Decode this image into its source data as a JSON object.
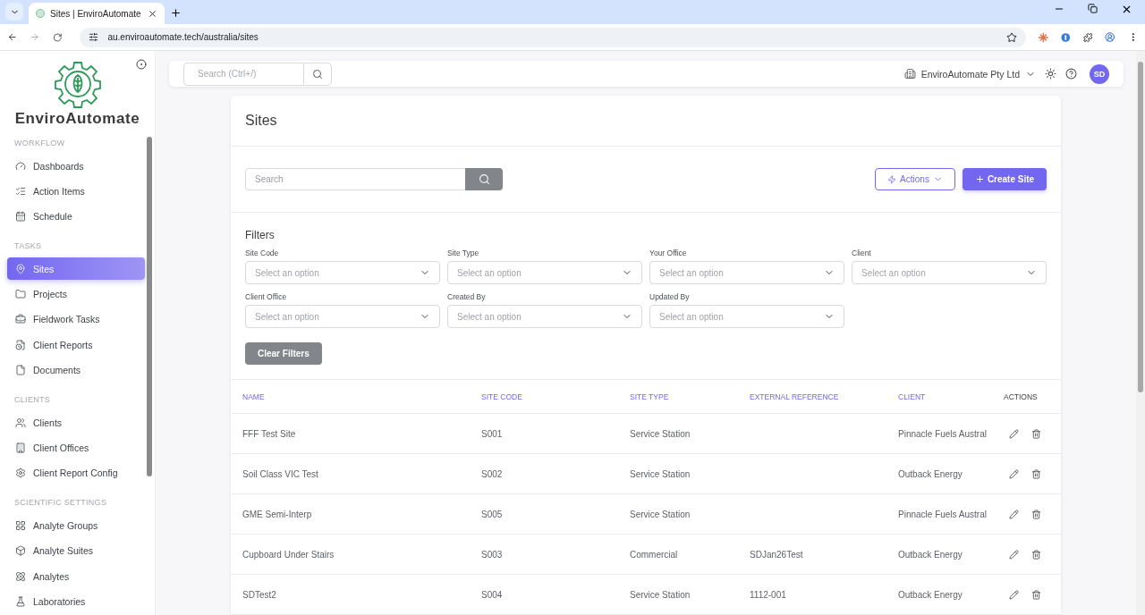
{
  "browser": {
    "tab_title": "Sites | EnviroAutomate",
    "url": "au.enviroautomate.tech/australia/sites"
  },
  "sidebar": {
    "brand": "EnviroAutomate",
    "sections": [
      {
        "title": "WORKFLOW",
        "items": [
          {
            "label": "Dashboards",
            "selected": false
          },
          {
            "label": "Action Items",
            "selected": false
          },
          {
            "label": "Schedule",
            "selected": false
          }
        ]
      },
      {
        "title": "TASKS",
        "items": [
          {
            "label": "Sites",
            "selected": true
          },
          {
            "label": "Projects",
            "selected": false
          },
          {
            "label": "Fieldwork Tasks",
            "selected": false
          },
          {
            "label": "Client Reports",
            "selected": false
          },
          {
            "label": "Documents",
            "selected": false
          }
        ]
      },
      {
        "title": "CLIENTS",
        "items": [
          {
            "label": "Clients",
            "selected": false
          },
          {
            "label": "Client Offices",
            "selected": false
          },
          {
            "label": "Client Report Config",
            "selected": false
          }
        ]
      },
      {
        "title": "SCIENTIFIC SETTINGS",
        "items": [
          {
            "label": "Analyte Groups",
            "selected": false
          },
          {
            "label": "Analyte Suites",
            "selected": false
          },
          {
            "label": "Analytes",
            "selected": false
          },
          {
            "label": "Laboratories",
            "selected": false
          }
        ]
      }
    ]
  },
  "header": {
    "search_placeholder": "Search (Ctrl+/)",
    "organisation": "EnviroAutomate Pty Ltd",
    "avatar": "SD"
  },
  "page": {
    "title": "Sites",
    "search_placeholder": "Search",
    "actions_button": "Actions",
    "create_button": "Create Site"
  },
  "filters": {
    "title": "Filters",
    "fields": [
      {
        "label": "Site Code",
        "placeholder": "Select an option"
      },
      {
        "label": "Site Type",
        "placeholder": "Select an option"
      },
      {
        "label": "Your Office",
        "placeholder": "Select an option"
      },
      {
        "label": "Client",
        "placeholder": "Select an option"
      },
      {
        "label": "Client Office",
        "placeholder": "Select an option"
      },
      {
        "label": "Created By",
        "placeholder": "Select an option"
      },
      {
        "label": "Updated By",
        "placeholder": "Select an option"
      }
    ],
    "clear_button": "Clear Filters"
  },
  "table": {
    "columns": [
      "NAME",
      "SITE CODE",
      "SITE TYPE",
      "EXTERNAL REFERENCE",
      "CLIENT",
      "ACTIONS"
    ],
    "rows": [
      {
        "name": "FFF Test Site",
        "site_code": "S001",
        "site_type": "Service Station",
        "external_reference": "",
        "client": "Pinnacle Fuels Austral"
      },
      {
        "name": "Soil Class VIC Test",
        "site_code": "S002",
        "site_type": "Service Station",
        "external_reference": "",
        "client": "Outback Energy"
      },
      {
        "name": "GME Semi-Interp",
        "site_code": "S005",
        "site_type": "Service Station",
        "external_reference": "",
        "client": "Pinnacle Fuels Austral"
      },
      {
        "name": "Cupboard Under Stairs",
        "site_code": "S003",
        "site_type": "Commercial",
        "external_reference": "SDJan26Test",
        "client": "Outback Energy"
      },
      {
        "name": "SDTest2",
        "site_code": "S004",
        "site_type": "Service Station",
        "external_reference": "1112-001",
        "client": "Outback Energy"
      }
    ]
  }
}
